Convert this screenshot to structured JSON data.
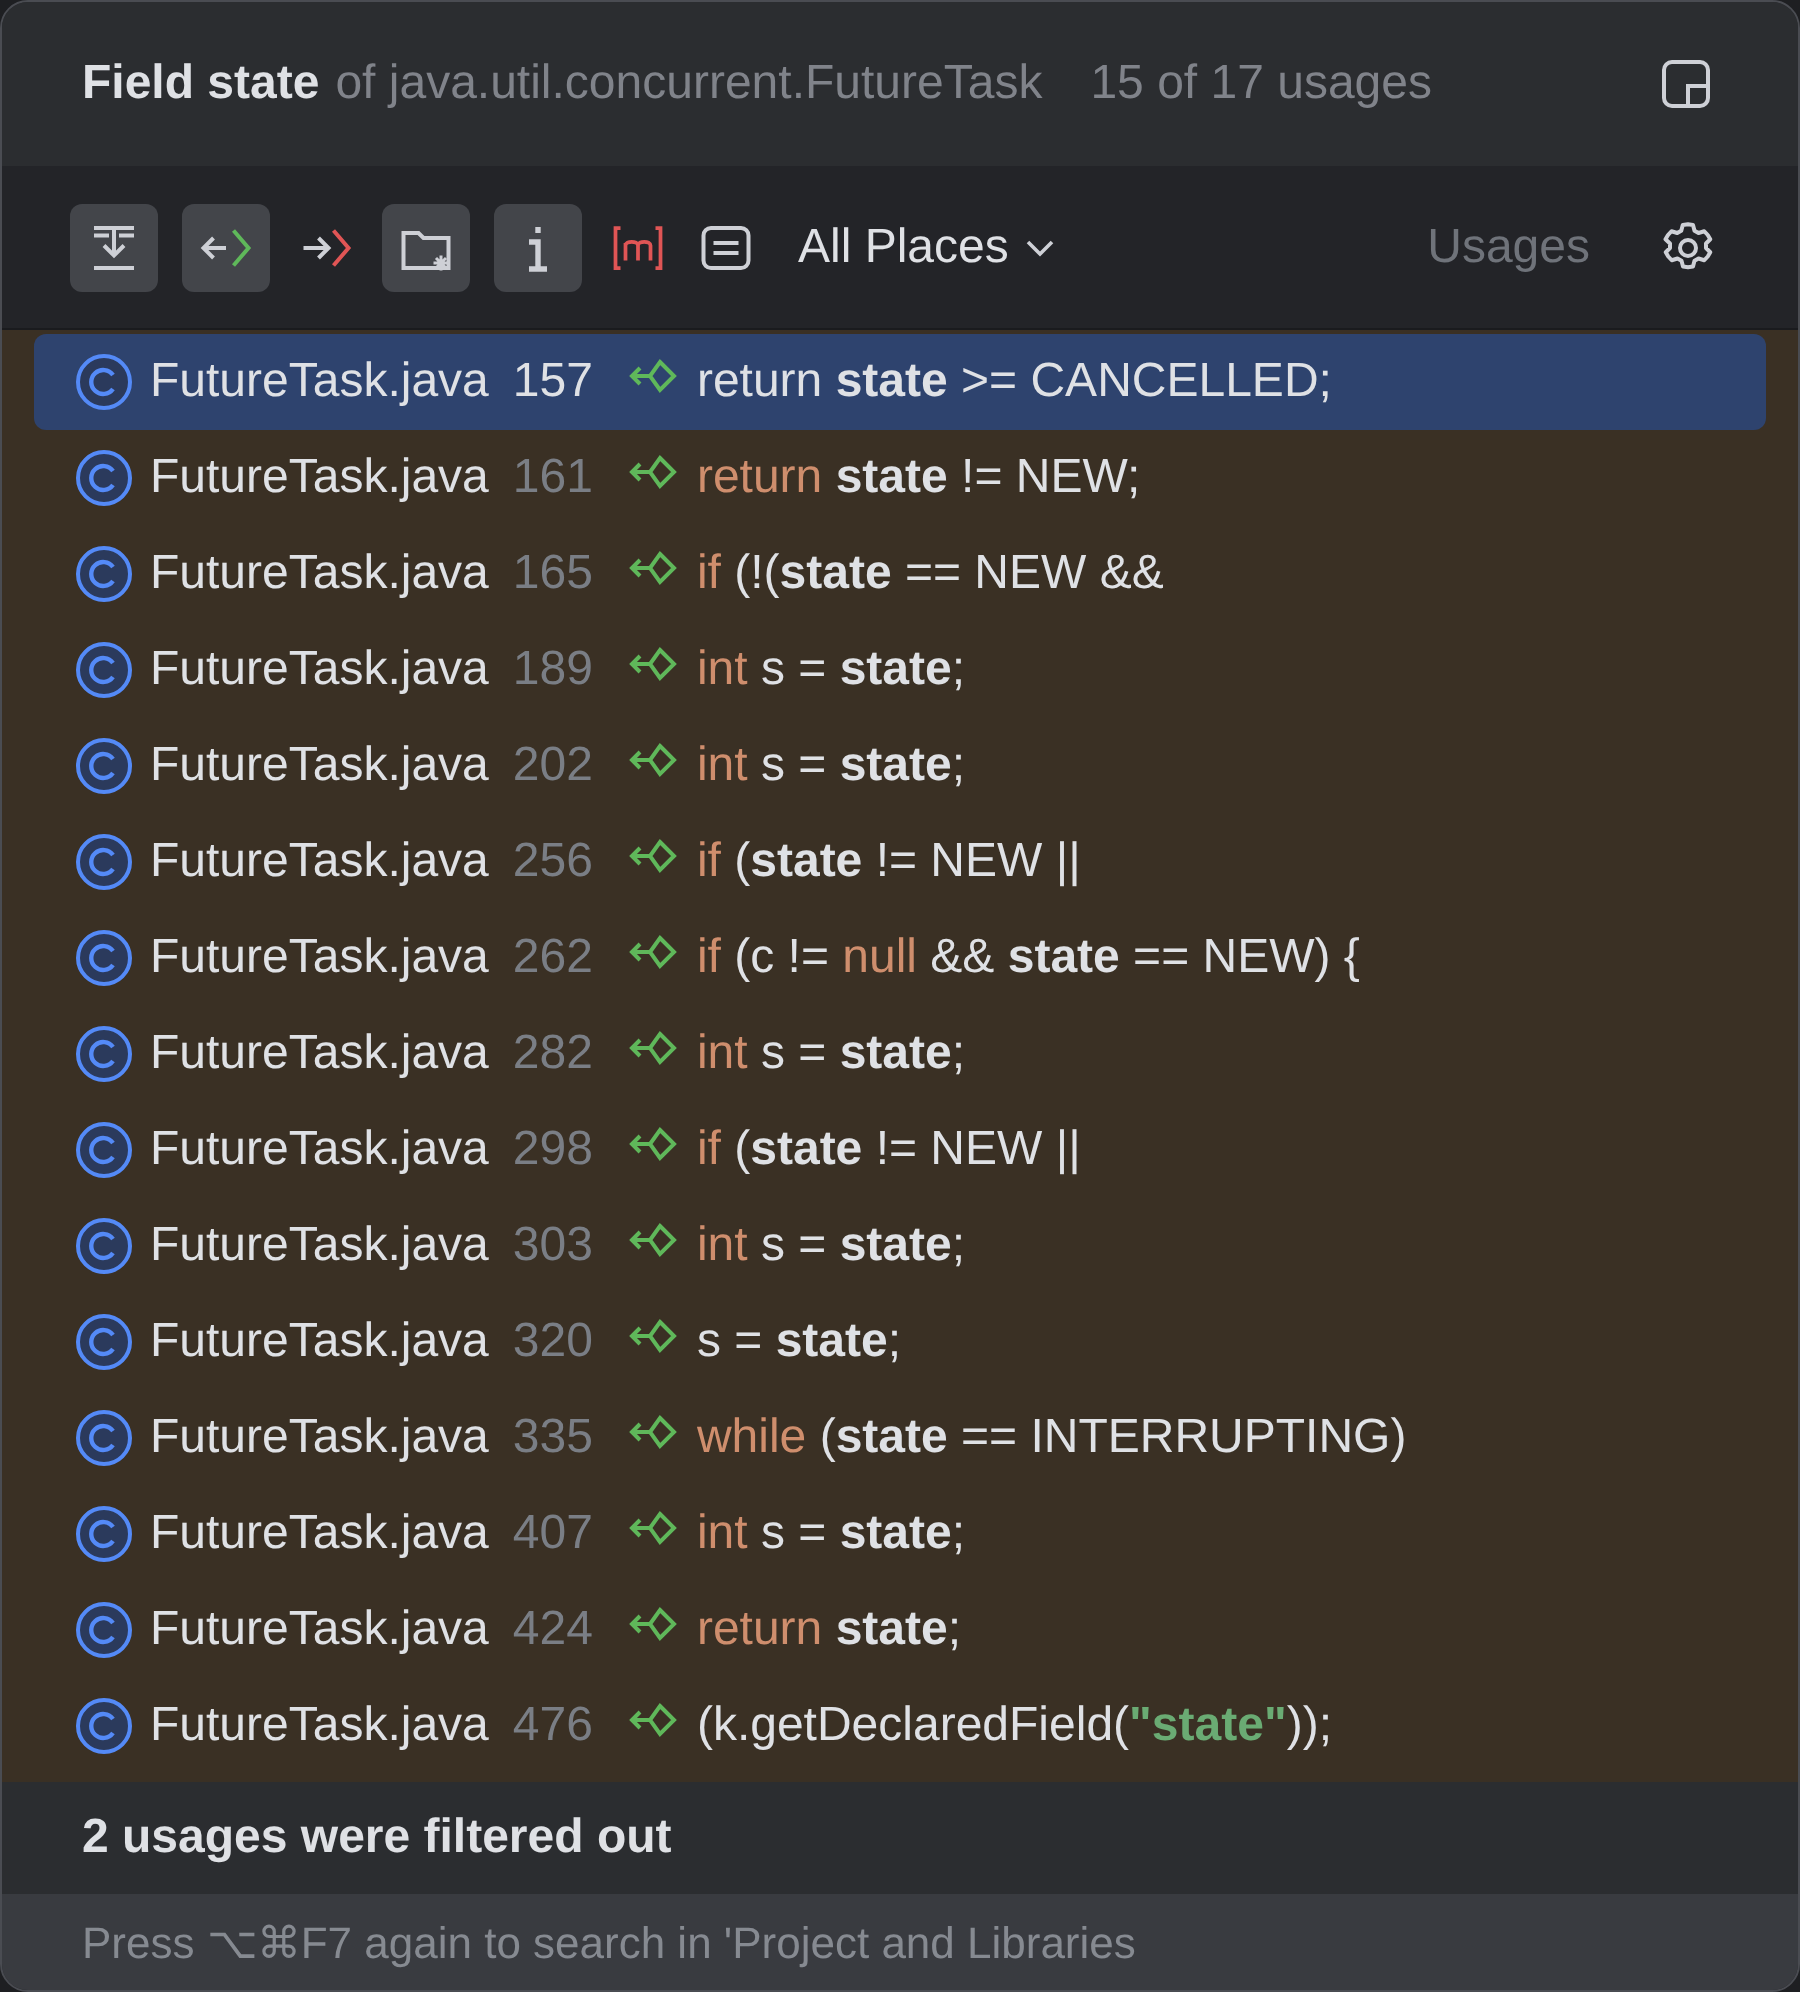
{
  "header": {
    "title": "Field state",
    "subtitle": "of java.util.concurrent.FutureTask",
    "count": "15 of 17 usages"
  },
  "toolbar": {
    "tools": [
      {
        "kind": "merge",
        "selected": true
      },
      {
        "kind": "read",
        "selected": true
      },
      {
        "kind": "write",
        "selected": false
      },
      {
        "kind": "folder",
        "selected": true
      },
      {
        "kind": "info",
        "selected": true
      },
      {
        "kind": "method",
        "selected": false
      },
      {
        "kind": "preview",
        "selected": false
      }
    ],
    "scope": "All Places",
    "usages_label": "Usages"
  },
  "rows": [
    {
      "file": "FutureTask.java",
      "line": "157",
      "selected": true,
      "code": [
        {
          "kind": "keyword",
          "text": "return "
        },
        {
          "kind": "field",
          "text": "state"
        },
        {
          "kind": "plain",
          "text": " >= CANCELLED;"
        }
      ]
    },
    {
      "file": "FutureTask.java",
      "line": "161",
      "selected": false,
      "code": [
        {
          "kind": "keyword",
          "text": "return "
        },
        {
          "kind": "field",
          "text": "state"
        },
        {
          "kind": "plain",
          "text": " != NEW;"
        }
      ]
    },
    {
      "file": "FutureTask.java",
      "line": "165",
      "selected": false,
      "code": [
        {
          "kind": "keyword",
          "text": "if "
        },
        {
          "kind": "plain",
          "text": "(!("
        },
        {
          "kind": "field",
          "text": "state"
        },
        {
          "kind": "plain",
          "text": " == NEW &&"
        }
      ]
    },
    {
      "file": "FutureTask.java",
      "line": "189",
      "selected": false,
      "code": [
        {
          "kind": "keyword",
          "text": "int "
        },
        {
          "kind": "plain",
          "text": "s = "
        },
        {
          "kind": "field",
          "text": "state"
        },
        {
          "kind": "plain",
          "text": ";"
        }
      ]
    },
    {
      "file": "FutureTask.java",
      "line": "202",
      "selected": false,
      "code": [
        {
          "kind": "keyword",
          "text": "int "
        },
        {
          "kind": "plain",
          "text": "s = "
        },
        {
          "kind": "field",
          "text": "state"
        },
        {
          "kind": "plain",
          "text": ";"
        }
      ]
    },
    {
      "file": "FutureTask.java",
      "line": "256",
      "selected": false,
      "code": [
        {
          "kind": "keyword",
          "text": "if "
        },
        {
          "kind": "plain",
          "text": "("
        },
        {
          "kind": "field",
          "text": "state"
        },
        {
          "kind": "plain",
          "text": " != NEW ||"
        }
      ]
    },
    {
      "file": "FutureTask.java",
      "line": "262",
      "selected": false,
      "code": [
        {
          "kind": "keyword",
          "text": "if "
        },
        {
          "kind": "plain",
          "text": "(c != "
        },
        {
          "kind": "keyword",
          "text": "null"
        },
        {
          "kind": "plain",
          "text": " && "
        },
        {
          "kind": "field",
          "text": "state"
        },
        {
          "kind": "plain",
          "text": " == NEW) {"
        }
      ]
    },
    {
      "file": "FutureTask.java",
      "line": "282",
      "selected": false,
      "code": [
        {
          "kind": "keyword",
          "text": "int "
        },
        {
          "kind": "plain",
          "text": "s = "
        },
        {
          "kind": "field",
          "text": "state"
        },
        {
          "kind": "plain",
          "text": ";"
        }
      ]
    },
    {
      "file": "FutureTask.java",
      "line": "298",
      "selected": false,
      "code": [
        {
          "kind": "keyword",
          "text": "if "
        },
        {
          "kind": "plain",
          "text": "("
        },
        {
          "kind": "field",
          "text": "state"
        },
        {
          "kind": "plain",
          "text": " != NEW ||"
        }
      ]
    },
    {
      "file": "FutureTask.java",
      "line": "303",
      "selected": false,
      "code": [
        {
          "kind": "keyword",
          "text": "int "
        },
        {
          "kind": "plain",
          "text": "s = "
        },
        {
          "kind": "field",
          "text": "state"
        },
        {
          "kind": "plain",
          "text": ";"
        }
      ]
    },
    {
      "file": "FutureTask.java",
      "line": "320",
      "selected": false,
      "code": [
        {
          "kind": "plain",
          "text": "s = "
        },
        {
          "kind": "field",
          "text": "state"
        },
        {
          "kind": "plain",
          "text": ";"
        }
      ]
    },
    {
      "file": "FutureTask.java",
      "line": "335",
      "selected": false,
      "code": [
        {
          "kind": "keyword",
          "text": "while "
        },
        {
          "kind": "plain",
          "text": "("
        },
        {
          "kind": "field",
          "text": "state"
        },
        {
          "kind": "plain",
          "text": " == INTERRUPTING)"
        }
      ]
    },
    {
      "file": "FutureTask.java",
      "line": "407",
      "selected": false,
      "code": [
        {
          "kind": "keyword",
          "text": "int "
        },
        {
          "kind": "plain",
          "text": "s = "
        },
        {
          "kind": "field",
          "text": "state"
        },
        {
          "kind": "plain",
          "text": ";"
        }
      ]
    },
    {
      "file": "FutureTask.java",
      "line": "424",
      "selected": false,
      "code": [
        {
          "kind": "keyword",
          "text": "return "
        },
        {
          "kind": "field",
          "text": "state"
        },
        {
          "kind": "plain",
          "text": ";"
        }
      ]
    },
    {
      "file": "FutureTask.java",
      "line": "476",
      "selected": false,
      "code": [
        {
          "kind": "plain",
          "text": "(k.getDeclaredField("
        },
        {
          "kind": "string",
          "text": "\"state\""
        },
        {
          "kind": "plain",
          "text": "));"
        }
      ]
    }
  ],
  "filtered_note": "2 usages were filtered out",
  "hint": "Press ⌥⌘F7 again to search in 'Project and Libraries"
}
